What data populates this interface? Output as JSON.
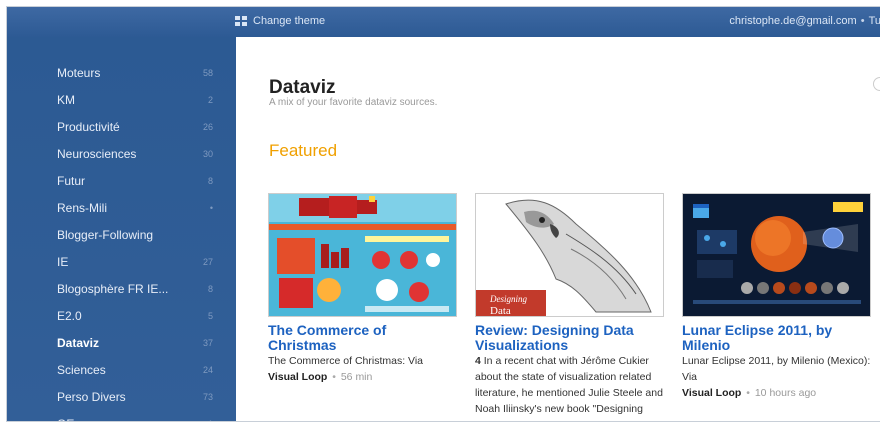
{
  "topbar": {
    "theme_label": "Change theme",
    "account_email": "christophe.de@gmail.com",
    "separator": "•",
    "account_extra": "Tu"
  },
  "sidebar": {
    "items": [
      {
        "label": "Moteurs",
        "count": "58"
      },
      {
        "label": "KM",
        "count": "2"
      },
      {
        "label": "Productivité",
        "count": "26"
      },
      {
        "label": "Neurosciences",
        "count": "30"
      },
      {
        "label": "Futur",
        "count": "8"
      },
      {
        "label": "Rens-Mili",
        "count": "•"
      },
      {
        "label": "Blogger-Following",
        "count": ""
      },
      {
        "label": "IE",
        "count": "27"
      },
      {
        "label": "Blogosphère FR IE...",
        "count": "8"
      },
      {
        "label": "E2.0",
        "count": "5"
      },
      {
        "label": "Dataviz",
        "count": "37"
      },
      {
        "label": "Sciences",
        "count": "24"
      },
      {
        "label": "Perso Divers",
        "count": "73"
      },
      {
        "label": "OE",
        "count": "1"
      }
    ],
    "active_index": 10
  },
  "main": {
    "title": "Dataviz",
    "subtitle": "A mix of your favorite dataviz sources.",
    "section": "Featured"
  },
  "cards": [
    {
      "thumb_icon": "christmas-infographic-thumbnail",
      "title": "The Commerce of Christmas",
      "desc": "The Commerce of Christmas: Via",
      "source": "Visual Loop",
      "time": "56 min"
    },
    {
      "thumb_icon": "book-cover-parrot-thumbnail",
      "thumb_caption": "Designing",
      "thumb_caption2": "Data",
      "title": "Review: Designing Data Visualizations",
      "num": "4",
      "desc": "In a recent chat with Jérôme Cukier about the state of visualization related literature, he mentioned Julie Steele and Noah Iliinsky's new book \"Designing Data",
      "source": "",
      "time": ""
    },
    {
      "thumb_icon": "lunar-eclipse-infographic-thumbnail",
      "title": "Lunar Eclipse 2011, by Milenio",
      "desc": "Lunar Eclipse 2011, by Milenio (Mexico): Via",
      "source": "Visual Loop",
      "time": "10 hours ago"
    }
  ],
  "colors": {
    "accent_blue": "#2d5a94",
    "link_blue": "#1d62c0",
    "featured_orange": "#f0a000"
  }
}
